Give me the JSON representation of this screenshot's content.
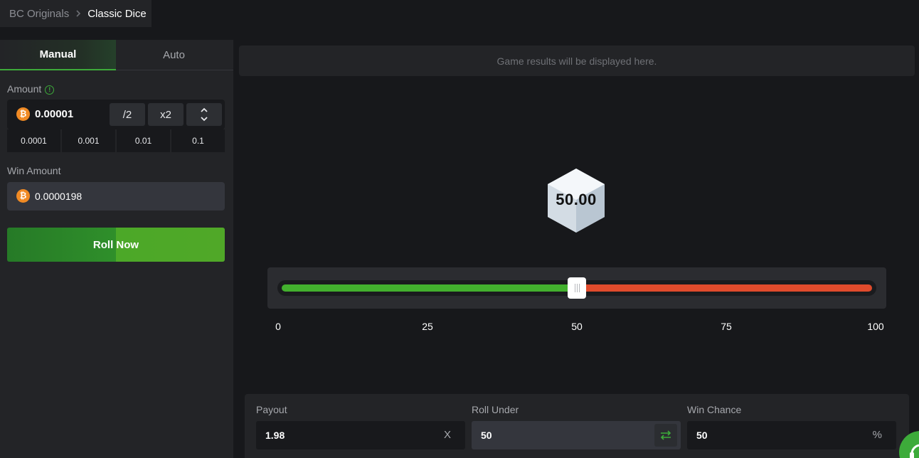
{
  "breadcrumb": {
    "parent": "BC Originals",
    "current": "Classic Dice"
  },
  "tabs": {
    "manual": "Manual",
    "auto": "Auto"
  },
  "amount": {
    "label": "Amount",
    "value": "0.00001",
    "half_label": "/2",
    "double_label": "x2",
    "presets": [
      "0.0001",
      "0.001",
      "0.01",
      "0.1"
    ]
  },
  "win_amount": {
    "label": "Win Amount",
    "value": "0.0000198"
  },
  "roll_button": "Roll Now",
  "results_placeholder": "Game results will be displayed here.",
  "dice_value": "50.00",
  "slider": {
    "value_percent": 50,
    "ticks": [
      "0",
      "25",
      "50",
      "75",
      "100"
    ],
    "win_color": "#43b02e",
    "lose_color": "#e04b2c"
  },
  "payout": {
    "label": "Payout",
    "value": "1.98",
    "suffix": "X"
  },
  "roll_under": {
    "label": "Roll Under",
    "value": "50"
  },
  "win_chance": {
    "label": "Win Chance",
    "value": "50",
    "suffix": "%"
  },
  "icons": {
    "currency": "bitcoin-icon",
    "info": "info-icon",
    "stepper": "chevron-up-down-icon",
    "swap": "swap-arrows-icon",
    "support": "headset-icon"
  },
  "colors": {
    "accent": "#3dab3a",
    "btc": "#f08a24"
  }
}
